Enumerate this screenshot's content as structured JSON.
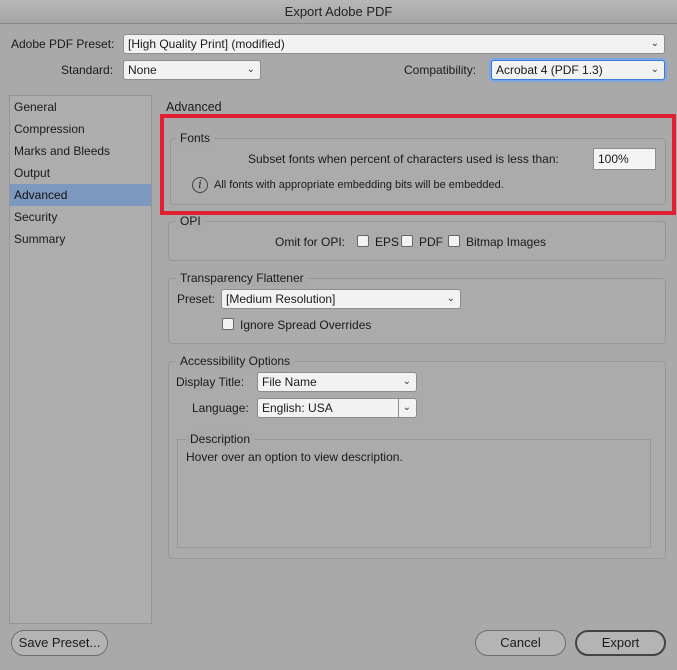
{
  "window": {
    "title": "Export Adobe PDF"
  },
  "preset": {
    "label": "Adobe PDF Preset:",
    "value": "[High Quality Print] (modified)"
  },
  "standard": {
    "label": "Standard:",
    "value": "None"
  },
  "compatibility": {
    "label": "Compatibility:",
    "value": "Acrobat 4 (PDF 1.3)"
  },
  "sidebar": {
    "items": [
      {
        "label": "General"
      },
      {
        "label": "Compression"
      },
      {
        "label": "Marks and Bleeds"
      },
      {
        "label": "Output"
      },
      {
        "label": "Advanced"
      },
      {
        "label": "Security"
      },
      {
        "label": "Summary"
      }
    ]
  },
  "main": {
    "heading": "Advanced",
    "fonts": {
      "title": "Fonts",
      "subset_label": "Subset fonts when percent of characters used is less than:",
      "subset_value": "100%",
      "info_text": "All fonts with appropriate embedding bits will be embedded."
    },
    "opi": {
      "title": "OPI",
      "omit_label": "Omit for OPI:",
      "eps_label": "EPS",
      "pdf_label": "PDF",
      "bitmap_label": "Bitmap Images"
    },
    "transparency": {
      "title": "Transparency Flattener",
      "preset_label": "Preset:",
      "preset_value": "[Medium Resolution]",
      "ignore_label": "Ignore Spread Overrides"
    },
    "accessibility": {
      "title": "Accessibility Options",
      "display_title_label": "Display Title:",
      "display_title_value": "File Name",
      "language_label": "Language:",
      "language_value": "English: USA"
    },
    "description": {
      "title": "Description",
      "text": "Hover over an option to view description."
    }
  },
  "buttons": {
    "save_preset": "Save Preset...",
    "cancel": "Cancel",
    "export": "Export"
  },
  "colors": {
    "highlight": "#e02030",
    "selection": "#7e99c0",
    "focus": "#3d7bd6"
  }
}
